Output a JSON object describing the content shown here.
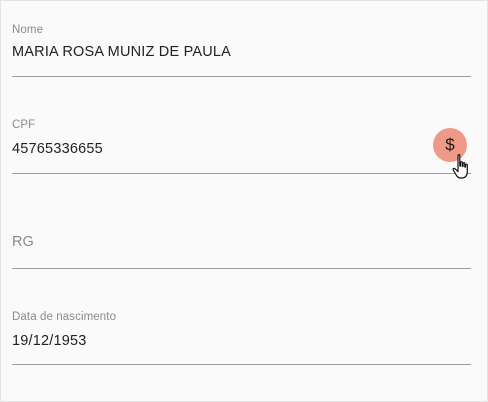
{
  "form": {
    "nome": {
      "label": "Nome",
      "value": "MARIA ROSA MUNIZ DE PAULA"
    },
    "cpf": {
      "label": "CPF",
      "value": "45765336655",
      "action_icon": "dollar-icon",
      "action_glyph": "$",
      "action_color": "#ef9a86"
    },
    "rg": {
      "placeholder": "RG"
    },
    "nascimento": {
      "label": "Data de nascimento",
      "value": "19/12/1953"
    }
  }
}
